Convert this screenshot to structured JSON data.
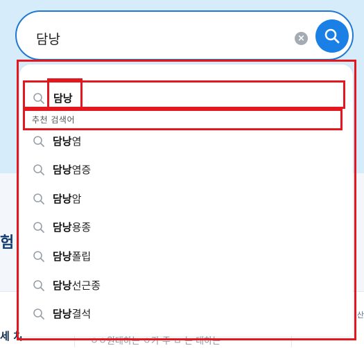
{
  "search": {
    "query": "담낭",
    "clear_icon": "clear-icon",
    "search_icon": "search-icon"
  },
  "dropdown": {
    "current_query": "담낭",
    "section_label": "추천 검색어",
    "suggestions": [
      {
        "bold": "담낭",
        "rest": "염"
      },
      {
        "bold": "담낭",
        "rest": "염증"
      },
      {
        "bold": "담낭",
        "rest": "암"
      },
      {
        "bold": "담낭",
        "rest": "용종"
      },
      {
        "bold": "담낭",
        "rest": "폴립"
      },
      {
        "bold": "담낭",
        "rest": "선근종"
      },
      {
        "bold": "담낭",
        "rest": "결석"
      }
    ]
  },
  "background": {
    "left_heading_fragment": "험",
    "left_bottom_fragment": "세 치",
    "right_small_fragment": "산",
    "bottom_faded_text": "ㅇㅇ원대하는 ㅇ가 주 ㅁ 는 대하는",
    "bottom_right_fragment": "ㅇㅇ원"
  },
  "colors": {
    "accent": "#1a80e5",
    "highlight_frame": "#e4161e",
    "top_background": "#d6ecfb"
  }
}
